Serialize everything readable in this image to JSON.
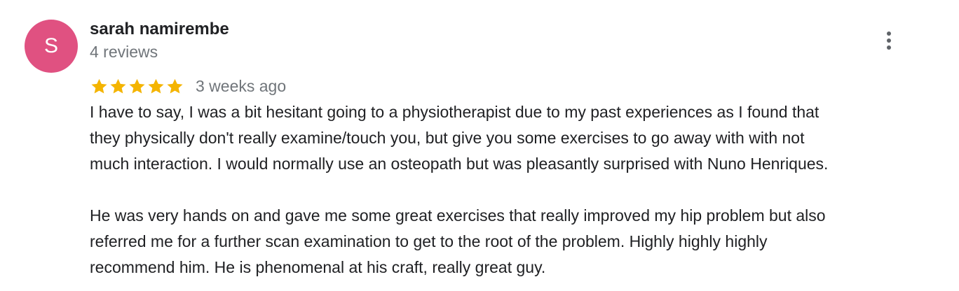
{
  "review": {
    "avatar": {
      "initial": "S",
      "color": "#e05181"
    },
    "author_name": "sarah namirembe",
    "review_count": "4 reviews",
    "rating": 5,
    "rating_max": 5,
    "star_color": "#f4b400",
    "date": "3 weeks ago",
    "menu_icon": "more-vert-icon",
    "paragraphs": [
      "I have to say, I was a bit hesitant going to a physiotherapist due to my past experiences as I found that\nthey physically don't really examine/touch you, but give you some exercises to go away with with not\nmuch interaction. I would normally use an osteopath but was pleasantly surprised with Nuno Henriques.",
      "He was very hands on and gave me some great exercises that really improved my hip problem but also\nreferred me for a further scan examination to get to the root of the problem. Highly highly highly\nrecommend him. He is phenomenal at his craft, really great guy."
    ]
  }
}
